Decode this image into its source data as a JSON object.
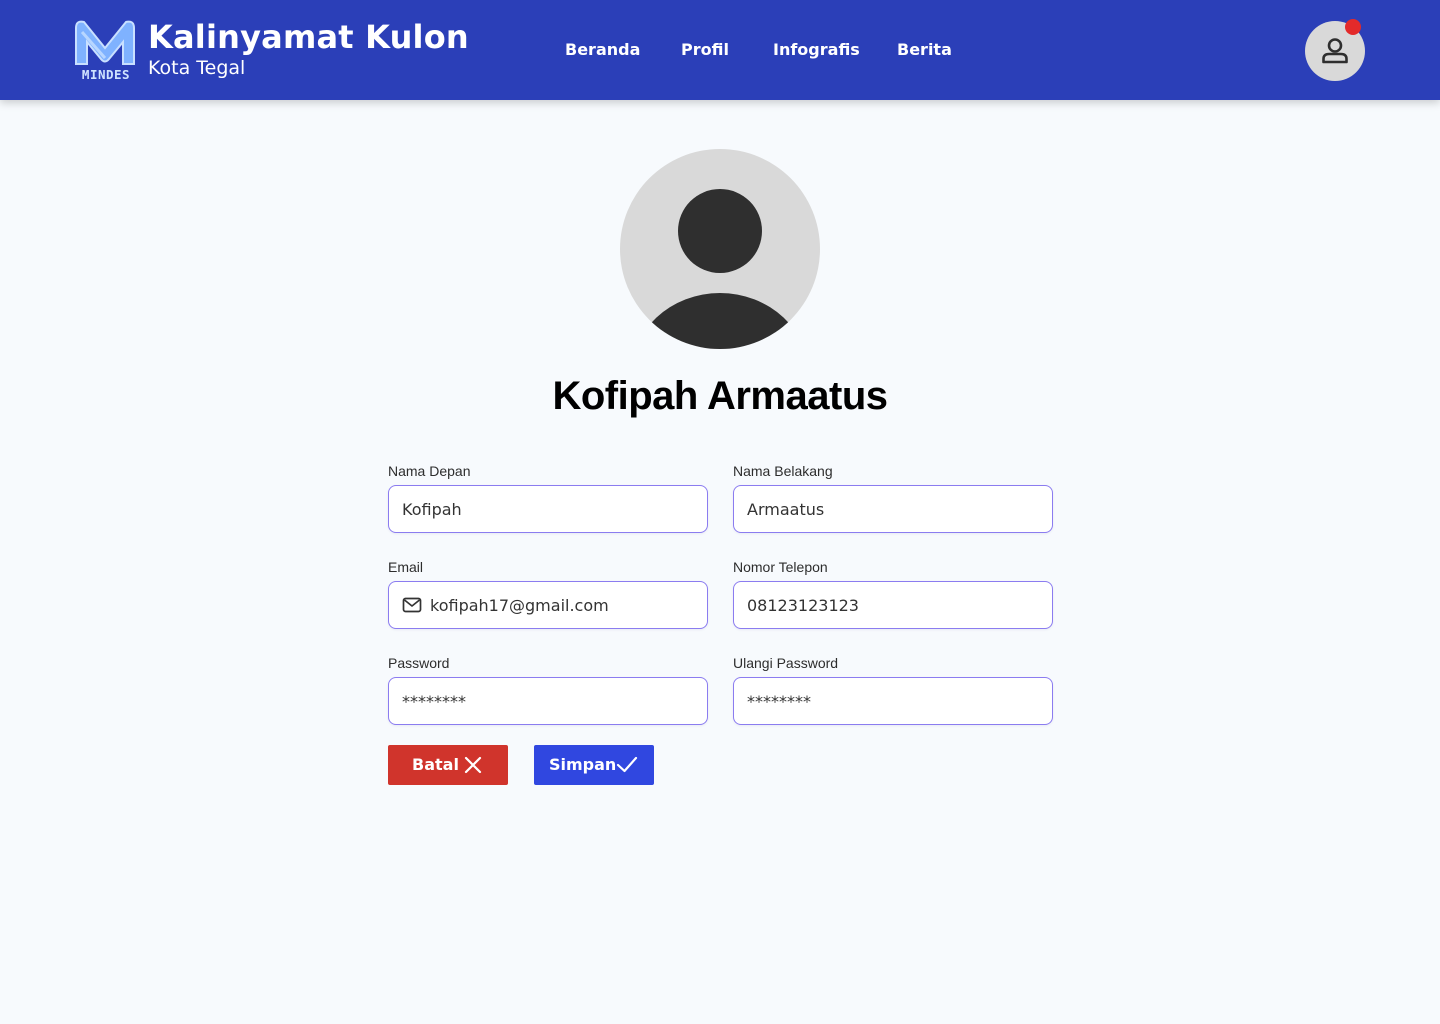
{
  "header": {
    "logo_text": "MINDES",
    "title": "Kalinyamat Kulon",
    "subtitle": "Kota Tegal",
    "nav": [
      {
        "label": "Beranda"
      },
      {
        "label": "Profil"
      },
      {
        "label": "Infografis"
      },
      {
        "label": "Berita"
      }
    ],
    "account_icon": "user-icon",
    "notification_color": "#e32a2a"
  },
  "profile": {
    "avatar_icon": "person-silhouette",
    "full_name": "Kofipah Armaatus"
  },
  "form": {
    "first_name": {
      "label": "Nama Depan",
      "value": "Kofipah"
    },
    "last_name": {
      "label": "Nama Belakang",
      "value": "Armaatus"
    },
    "email": {
      "label": "Email",
      "value": "kofipah17@gmail.com",
      "icon": "mail-icon"
    },
    "phone": {
      "label": "Nomor Telepon",
      "value": "08123123123"
    },
    "password": {
      "label": "Password",
      "value": "********"
    },
    "confirm_password": {
      "label": "Ulangi Password",
      "value": "********"
    }
  },
  "actions": {
    "cancel": {
      "label": "Batal",
      "icon": "close-icon",
      "color": "#d0342c"
    },
    "save": {
      "label": "Simpan",
      "icon": "check-icon",
      "color": "#3047e0"
    }
  },
  "theme": {
    "header_bg": "#2b3fb8",
    "page_bg": "#f7fafd",
    "input_border": "#8b7cf0"
  }
}
